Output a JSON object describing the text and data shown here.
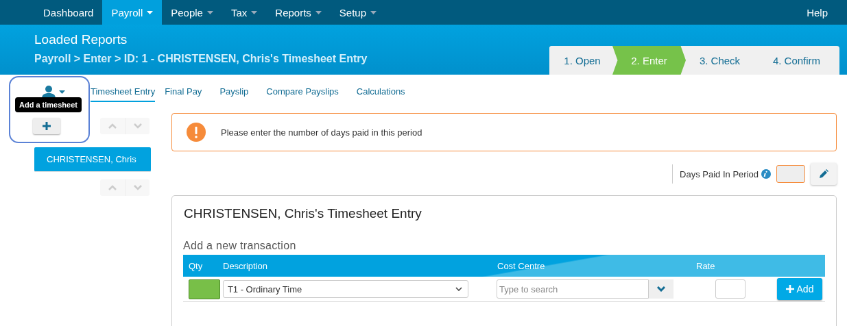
{
  "nav": {
    "items": [
      {
        "label": "Dashboard",
        "dropdown": false,
        "selected": false
      },
      {
        "label": "Payroll",
        "dropdown": true,
        "selected": true
      },
      {
        "label": "People",
        "dropdown": true,
        "selected": false
      },
      {
        "label": "Tax",
        "dropdown": true,
        "selected": false
      },
      {
        "label": "Reports",
        "dropdown": true,
        "selected": false
      },
      {
        "label": "Setup",
        "dropdown": true,
        "selected": false
      }
    ],
    "help": "Help"
  },
  "header": {
    "title": "Loaded Reports",
    "breadcrumb": "Payroll > Enter > ID: 1 - CHRISTENSEN, Chris's Timesheet Entry"
  },
  "steps": [
    {
      "label": "1. Open",
      "selected": false
    },
    {
      "label": "2. Enter",
      "selected": true
    },
    {
      "label": "3. Check",
      "selected": false
    },
    {
      "label": "4. Confirm",
      "selected": false
    }
  ],
  "tooltip": "Add a timesheet",
  "tabs": [
    {
      "label": "Timesheet Entry",
      "selected": true
    },
    {
      "label": "Final Pay",
      "selected": false
    },
    {
      "label": "Payslip",
      "selected": false
    },
    {
      "label": "Compare Payslips",
      "selected": false
    },
    {
      "label": "Calculations",
      "selected": false
    }
  ],
  "employees": [
    {
      "name": "CHRISTENSEN, Chris",
      "selected": true
    }
  ],
  "alert": {
    "message": "Please enter the number of days paid in this period"
  },
  "days_paid": {
    "label": "Days Paid In Period"
  },
  "card": {
    "title": "CHRISTENSEN, Chris's Timesheet Entry",
    "subtitle": "Add a new transaction",
    "columns": [
      "Qty",
      "Description",
      "Cost Centre",
      "Rate"
    ],
    "row": {
      "description": "T1 - Ordinary Time",
      "cost_centre_placeholder": "Type to search"
    },
    "add_button": "Add"
  }
}
